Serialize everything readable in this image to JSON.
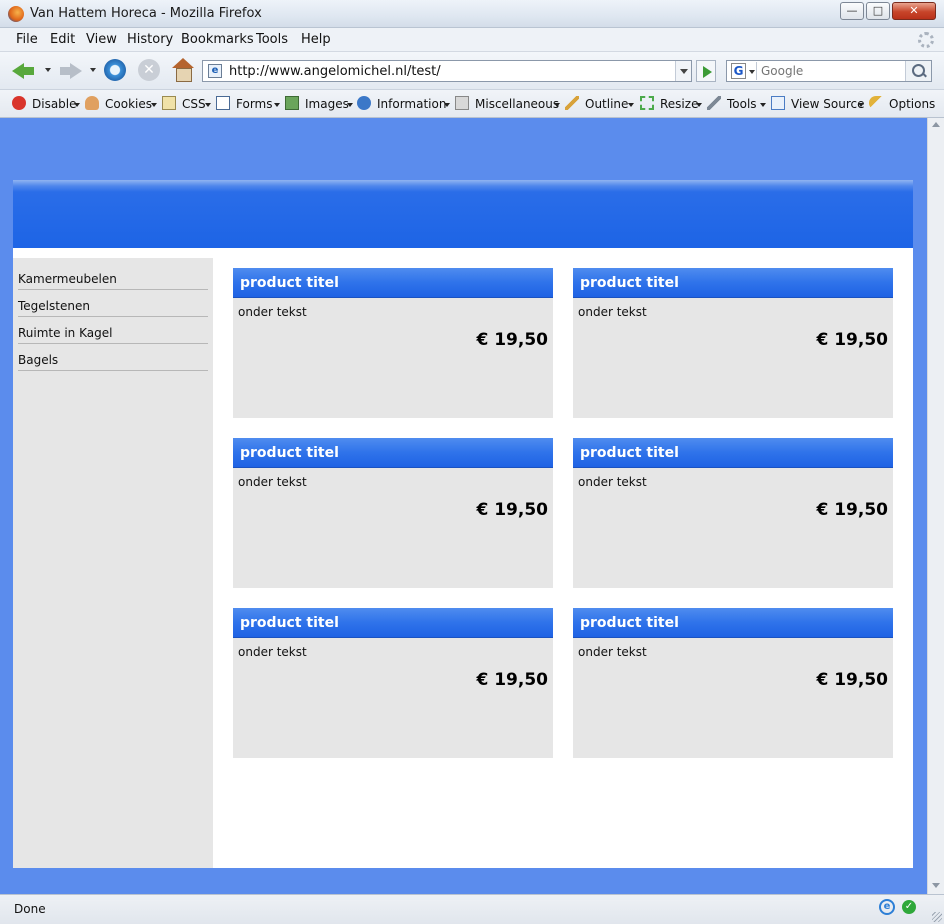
{
  "window": {
    "title": "Van Hattem Horeca - Mozilla Firefox",
    "minimize_glyph": "—",
    "maximize_glyph": "□",
    "close_glyph": "✕"
  },
  "menu": {
    "file": "File",
    "edit": "Edit",
    "view": "View",
    "history": "History",
    "bookmarks": "Bookmarks",
    "tools": "Tools",
    "help": "Help"
  },
  "nav": {
    "url": "http://www.angelomichel.nl/test/",
    "search_placeholder": "Google",
    "search_engine_letter": "G",
    "page_icon_letter": "e",
    "stop_glyph": "✕"
  },
  "webdev_toolbar": {
    "disable": "Disable",
    "cookies": "Cookies",
    "css": "CSS",
    "forms": "Forms",
    "images": "Images",
    "information": "Information",
    "miscellaneous": "Miscellaneous",
    "outline": "Outline",
    "resize": "Resize",
    "tools": "Tools",
    "view_source": "View Source",
    "options": "Options"
  },
  "sidebar": {
    "items": [
      {
        "label": "Kamermeubelen"
      },
      {
        "label": "Tegelstenen"
      },
      {
        "label": "Ruimte in Kagel"
      },
      {
        "label": "Bagels"
      }
    ]
  },
  "products": [
    {
      "title": "product titel",
      "subtitle": "onder tekst",
      "price": "€ 19,50"
    },
    {
      "title": "product titel",
      "subtitle": "onder tekst",
      "price": "€ 19,50"
    },
    {
      "title": "product titel",
      "subtitle": "onder tekst",
      "price": "€ 19,50"
    },
    {
      "title": "product titel",
      "subtitle": "onder tekst",
      "price": "€ 19,50"
    },
    {
      "title": "product titel",
      "subtitle": "onder tekst",
      "price": "€ 19,50"
    },
    {
      "title": "product titel",
      "subtitle": "onder tekst",
      "price": "€ 19,50"
    }
  ],
  "status": {
    "text": "Done",
    "ie_letter": "e",
    "ok_glyph": "✓"
  },
  "colors": {
    "page_background": "#5b8ced",
    "header_blue": "#1d64e6",
    "card_background": "#e6e6e6",
    "sidebar_background": "#e6e6e6"
  }
}
